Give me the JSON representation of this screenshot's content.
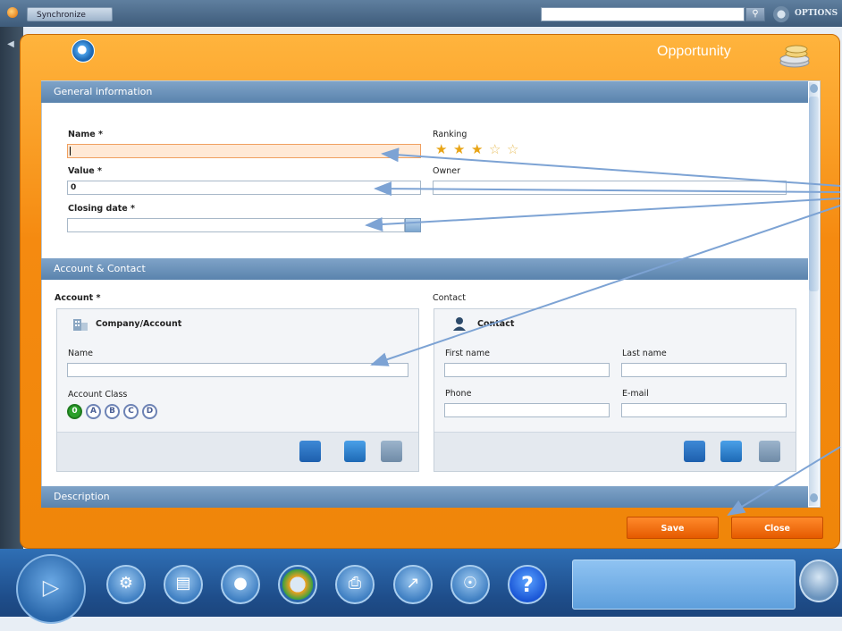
{
  "topbar": {
    "synchronize_label": "Synchronize",
    "search_value": "",
    "options_label": "OPTIONS"
  },
  "header": {
    "title": "Opportunity"
  },
  "sections": {
    "general": "General information",
    "account_contact": "Account & Contact",
    "description": "Description"
  },
  "general": {
    "name_label": "Name *",
    "name_value": "",
    "value_label": "Value *",
    "value_value": "0",
    "closing_label": "Closing date *",
    "closing_value": "",
    "ranking_label": "Ranking",
    "ranking_stars": 3,
    "ranking_max": 5,
    "owner_label": "Owner",
    "owner_value": ""
  },
  "account": {
    "label": "Account *",
    "box_title": "Company/Account",
    "name_label": "Name",
    "name_value": "",
    "class_label": "Account Class",
    "classes": [
      "0",
      "A",
      "B",
      "C",
      "D"
    ],
    "selected_class": "0"
  },
  "contact": {
    "label": "Contact",
    "box_title": "Contact",
    "first_name_label": "First name",
    "last_name_label": "Last name",
    "phone_label": "Phone",
    "email_label": "E-mail"
  },
  "actions": {
    "save_label": "Save",
    "close_label": "Close"
  },
  "dock": {
    "help_glyph": "?"
  },
  "colors": {
    "accent_orange": "#f58a10",
    "section_blue": "#5a83ad",
    "star_gold": "#e8a415",
    "focus_field": "#ffe9d6",
    "class_selected": "#2aa02a"
  },
  "icons": {
    "header": "search-magnifier-icon",
    "title_badge": "coins-icon",
    "dock": [
      "gear-icon",
      "layers-icon",
      "contact-icon",
      "donut-chart-icon",
      "printer-icon",
      "line-chart-icon",
      "lifebuoy-icon",
      "help-icon"
    ]
  }
}
